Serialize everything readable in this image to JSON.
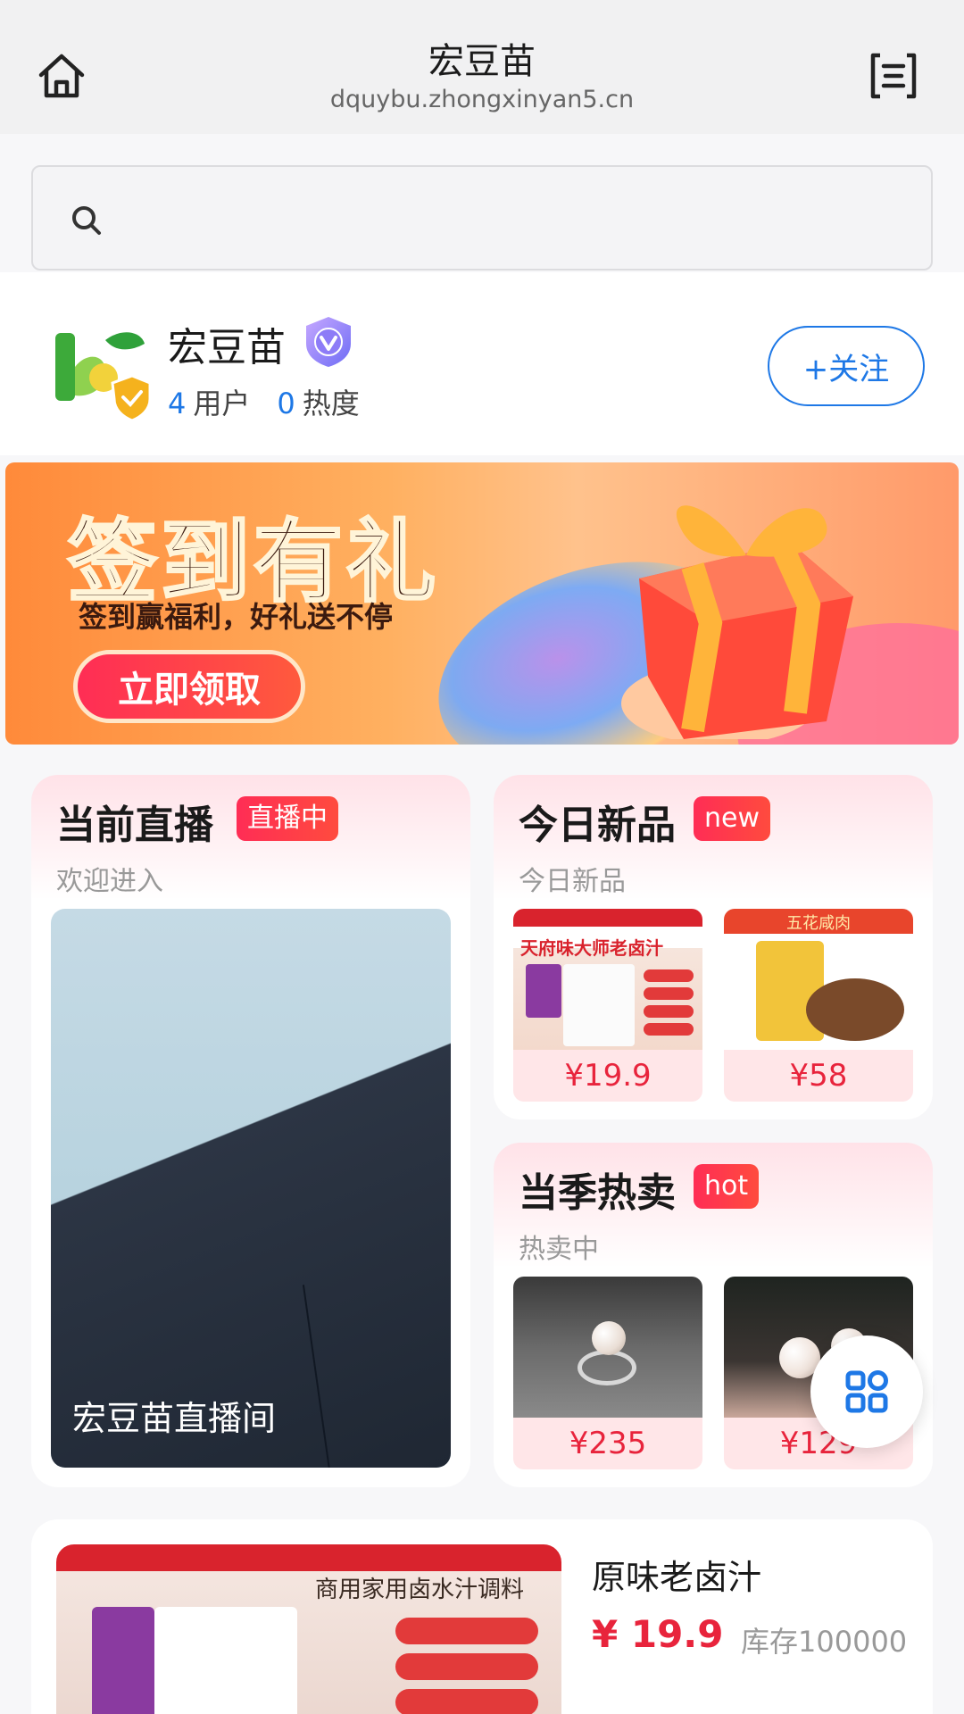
{
  "header": {
    "title": "宏豆苗",
    "url": "dquybu.zhongxinyan5.cn"
  },
  "search": {
    "placeholder": ""
  },
  "shop": {
    "name": "宏豆苗",
    "users_count": "4",
    "users_label": "用户",
    "heat_count": "0",
    "heat_label": "热度",
    "follow_label": "+关注"
  },
  "banner": {
    "title": "签到有礼",
    "subtitle": "签到赢福利，好礼送不停",
    "cta": "立即领取"
  },
  "live": {
    "title": "当前直播",
    "tag": "直播中",
    "subtitle": "欢迎进入",
    "caption": "宏豆苗直播间"
  },
  "new_products": {
    "title": "今日新品",
    "tag": "new",
    "subtitle": "今日新品",
    "items": [
      {
        "price": "¥19.9",
        "img_text": "天府味大师老卤汁"
      },
      {
        "price": "¥58",
        "img_text": "五花咸肉"
      }
    ]
  },
  "hot_products": {
    "title": "当季热卖",
    "tag": "hot",
    "subtitle": "热卖中",
    "items": [
      {
        "price": "¥235"
      },
      {
        "price": "¥129"
      }
    ]
  },
  "list_item": {
    "name": "原味老卤汁",
    "price": "¥ 19.9",
    "stock": "库存100000",
    "img_text": "商用家用卤水汁调料"
  },
  "colors": {
    "accent": "#1e78e6",
    "price": "#e8243c",
    "tag_gradient_start": "#ff2d55"
  }
}
